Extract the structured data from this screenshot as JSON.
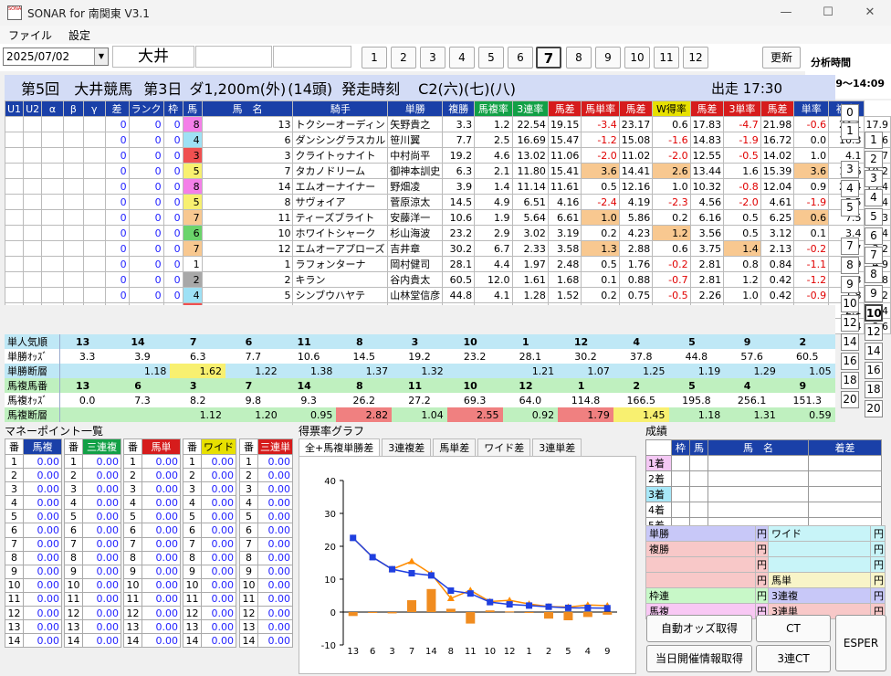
{
  "window": {
    "title": "SONAR for 南関東 V3.1",
    "icon_text": "SONAR",
    "min_glyph": "—",
    "max_glyph": "☐",
    "close_glyph": "✕"
  },
  "menu": [
    "ファイル",
    "設定"
  ],
  "toolbar": {
    "date": "2025/07/02",
    "venue": "大井",
    "races": [
      "1",
      "2",
      "3",
      "4",
      "5",
      "6",
      "7",
      "8",
      "9",
      "10",
      "11",
      "12"
    ],
    "selected_race": "7",
    "update_label": "更新"
  },
  "analysis": {
    "label": "分析時間",
    "time": "14:09～14:09"
  },
  "race": {
    "round": "第5回",
    "course": "大井競馬",
    "day": "第3日",
    "distance": "ダ1,200m(外)",
    "heads": "(14頭)",
    "start_label": "発走時刻",
    "class": "C2(六)(七)(八)",
    "post": "出走 17:30"
  },
  "table": {
    "headers": [
      "U1",
      "U2",
      "α",
      "β",
      "γ",
      "差",
      "ランク",
      "枠",
      "馬",
      "馬　名",
      "騎手",
      "単勝",
      "複勝",
      "馬複率",
      "3連率",
      "馬差",
      "馬単率",
      "馬差",
      "W得率",
      "馬差",
      "3単率",
      "馬差",
      "単率",
      "複率"
    ],
    "rows": [
      {
        "g": "0",
        "d": "0",
        "r": "0",
        "w": "8",
        "wc": "hl-p",
        "n": "13",
        "name": "トクシーオーディン",
        "j": "矢野貴之",
        "t": "3.3",
        "f": "1.2",
        "v": [
          "22.54",
          "19.15",
          "-3.4",
          "23.17",
          "0.6",
          "17.83",
          "-4.7",
          "21.98",
          "-0.6",
          "24.1",
          "17.9"
        ],
        "h": [
          "",
          "",
          "",
          "",
          "",
          "",
          "",
          "",
          "",
          "",
          ""
        ]
      },
      {
        "g": "0",
        "d": "0",
        "r": "0",
        "w": "4",
        "wc": "hl-bl",
        "n": "6",
        "name": "ダンシングラスカル",
        "j": "笹川翼",
        "t": "7.7",
        "f": "2.5",
        "v": [
          "16.69",
          "15.47",
          "-1.2",
          "15.08",
          "-1.6",
          "14.83",
          "-1.9",
          "16.72",
          "0.0",
          "10.3",
          "8.6"
        ],
        "h": [
          "",
          "",
          "",
          "",
          "",
          "",
          "",
          "",
          "",
          "",
          ""
        ]
      },
      {
        "g": "0",
        "d": "0",
        "r": "0",
        "w": "3",
        "wc": "hl-r",
        "n": "3",
        "name": "クライトゥナイト",
        "j": "中村尚平",
        "t": "19.2",
        "f": "4.6",
        "v": [
          "13.02",
          "11.06",
          "-2.0",
          "11.02",
          "-2.0",
          "12.55",
          "-0.5",
          "14.02",
          "1.0",
          "4.1",
          "4.7"
        ],
        "h": [
          "",
          "",
          "",
          "",
          "",
          "",
          "",
          "",
          "",
          "",
          ""
        ]
      },
      {
        "g": "0",
        "d": "0",
        "r": "0",
        "w": "5",
        "wc": "hl-y",
        "n": "7",
        "name": "タカノドリーム",
        "j": "御神本訓史",
        "t": "6.3",
        "f": "2.1",
        "v": [
          "11.80",
          "15.41",
          "3.6",
          "14.41",
          "2.6",
          "13.44",
          "1.6",
          "15.39",
          "3.6",
          "12.6",
          "10.2"
        ],
        "h": [
          "",
          "",
          "hl-o",
          "",
          "hl-o",
          "",
          "",
          "",
          "hl-o",
          "",
          ""
        ]
      },
      {
        "g": "0",
        "d": "0",
        "r": "0",
        "w": "8",
        "wc": "hl-p",
        "n": "14",
        "name": "エムオーナイナー",
        "j": "野畑凌",
        "t": "3.9",
        "f": "1.4",
        "v": [
          "11.14",
          "11.61",
          "0.5",
          "12.16",
          "1.0",
          "10.32",
          "-0.8",
          "12.04",
          "0.9",
          "20.4",
          "15.4"
        ],
        "h": [
          "",
          "",
          "",
          "",
          "",
          "",
          "",
          "",
          "",
          "",
          ""
        ]
      },
      {
        "g": "0",
        "d": "0",
        "r": "0",
        "w": "5",
        "wc": "hl-y",
        "n": "8",
        "name": "サヴォイア",
        "j": "菅原涼太",
        "t": "14.5",
        "f": "4.9",
        "v": [
          "6.51",
          "4.16",
          "-2.4",
          "4.19",
          "-2.3",
          "4.56",
          "-2.0",
          "4.61",
          "-1.9",
          "5.5",
          "4.4"
        ],
        "h": [
          "",
          "",
          "",
          "",
          "",
          "",
          "",
          "",
          "",
          "",
          ""
        ]
      },
      {
        "g": "0",
        "d": "0",
        "r": "0",
        "w": "7",
        "wc": "hl-o",
        "n": "11",
        "name": "ティーズブライト",
        "j": "安藤洋一",
        "t": "10.6",
        "f": "1.9",
        "v": [
          "5.64",
          "6.61",
          "1.0",
          "5.86",
          "0.2",
          "6.16",
          "0.5",
          "6.25",
          "0.6",
          "7.5",
          "11.3"
        ],
        "h": [
          "",
          "",
          "hl-o",
          "",
          "",
          "",
          "",
          "",
          "hl-o",
          "",
          ""
        ]
      },
      {
        "g": "0",
        "d": "0",
        "r": "0",
        "w": "6",
        "wc": "hl-g",
        "n": "10",
        "name": "ホワイトシャーク",
        "j": "杉山海波",
        "t": "23.2",
        "f": "2.9",
        "v": [
          "3.02",
          "3.19",
          "0.2",
          "4.23",
          "1.2",
          "3.56",
          "0.5",
          "3.12",
          "0.1",
          "3.4",
          "7.4"
        ],
        "h": [
          "",
          "",
          "",
          "",
          "hl-o",
          "",
          "",
          "",
          "",
          "",
          ""
        ]
      },
      {
        "g": "0",
        "d": "0",
        "r": "0",
        "w": "7",
        "wc": "hl-o",
        "n": "12",
        "name": "エムオーアプローズ",
        "j": "吉井章",
        "t": "30.2",
        "f": "6.7",
        "v": [
          "2.33",
          "3.58",
          "1.3",
          "2.88",
          "0.6",
          "3.75",
          "1.4",
          "2.13",
          "-0.2",
          "2.7",
          "3.2"
        ],
        "h": [
          "",
          "",
          "hl-o",
          "",
          "",
          "",
          "hl-o",
          "",
          "",
          "",
          ""
        ]
      },
      {
        "g": "0",
        "d": "0",
        "r": "0",
        "w": "1",
        "wc": "",
        "n": "1",
        "name": "ラフォンターナ",
        "j": "岡村健司",
        "t": "28.1",
        "f": "4.4",
        "v": [
          "1.97",
          "2.48",
          "0.5",
          "1.76",
          "-0.2",
          "2.81",
          "0.8",
          "0.84",
          "-1.1",
          "2.9",
          "4.9"
        ],
        "h": [
          "",
          "",
          "",
          "",
          "",
          "",
          "",
          "",
          "",
          "",
          ""
        ]
      },
      {
        "g": "0",
        "d": "0",
        "r": "0",
        "w": "2",
        "wc": "hl-gr",
        "n": "2",
        "name": "キラン",
        "j": "谷内貴太",
        "t": "60.5",
        "f": "12.0",
        "v": [
          "1.61",
          "1.68",
          "0.1",
          "0.88",
          "-0.7",
          "2.81",
          "1.2",
          "0.42",
          "-1.2",
          "1.3",
          "1.8"
        ],
        "h": [
          "",
          "",
          "",
          "",
          "",
          "",
          "",
          "",
          "",
          "",
          ""
        ]
      },
      {
        "g": "0",
        "d": "0",
        "r": "0",
        "w": "4",
        "wc": "hl-bl",
        "n": "5",
        "name": "シンブウハヤテ",
        "j": "山林堂信彦",
        "t": "44.8",
        "f": "4.1",
        "v": [
          "1.28",
          "1.52",
          "0.2",
          "0.75",
          "-0.5",
          "2.26",
          "1.0",
          "0.42",
          "-0.9",
          "1.8",
          "5.2"
        ],
        "h": [
          "",
          "",
          "",
          "",
          "",
          "",
          "",
          "",
          "",
          "",
          ""
        ]
      },
      {
        "g": "0",
        "d": "0",
        "r": "0",
        "w": "3",
        "wc": "hl-r",
        "n": "4",
        "name": "イクノオリンピア",
        "j": "瀬川将輝",
        "t": "37.8",
        "f": "15.6",
        "v": [
          "1.26",
          "2.16",
          "0.9",
          "1.72",
          "0.5",
          "2.20",
          "0.9",
          "1.03",
          "-0.2",
          "2.1",
          "1.4"
        ],
        "h": [
          "",
          "",
          "",
          "",
          "",
          "",
          "",
          "",
          "",
          "",
          ""
        ]
      },
      {
        "g": "0",
        "d": "0",
        "r": "0",
        "w": "6",
        "wc": "hl-g",
        "n": "9",
        "name": "ショーシャンク",
        "j": "藤本現暉",
        "t": "57.6",
        "f": "6.0",
        "v": [
          "1.17",
          "1.93",
          "0.8",
          "1.89",
          "0.7",
          "2.92",
          "1.8",
          "1.03",
          "-0.1",
          "1.4",
          "3.6"
        ],
        "h": [
          "",
          "",
          "",
          "",
          "",
          "",
          "",
          "",
          "",
          "",
          ""
        ]
      }
    ]
  },
  "side_buttons_left": [
    "0",
    "1",
    "2",
    "3",
    "4",
    "5",
    "6",
    "7",
    "8",
    "9",
    "10",
    "11",
    "12",
    "13",
    "14",
    "15",
    "16",
    "17",
    "18",
    "19",
    "20"
  ],
  "side_buttons_right": [
    "1",
    "2",
    "3",
    "4",
    "5",
    "6",
    "7",
    "8",
    "9",
    "10",
    "12",
    "14",
    "16",
    "18",
    "20"
  ],
  "stats": {
    "tan_ninki": {
      "label": "単人気順",
      "values": [
        "13",
        "14",
        "7",
        "6",
        "11",
        "8",
        "3",
        "10",
        "1",
        "12",
        "4",
        "5",
        "9",
        "2"
      ]
    },
    "tan_odds": {
      "label": "単勝ｵｯｽﾞ",
      "values": [
        "3.3",
        "3.9",
        "6.3",
        "7.7",
        "10.6",
        "14.5",
        "19.2",
        "23.2",
        "28.1",
        "30.2",
        "37.8",
        "44.8",
        "57.6",
        "60.5"
      ]
    },
    "tan_dan": {
      "label": "単勝断層",
      "values": [
        "1.18",
        "1.62",
        "1.22",
        "1.38",
        "1.37",
        "1.32",
        "1.21",
        "1.07",
        "1.25",
        "1.19",
        "1.29",
        "1.05"
      ]
    },
    "fuku_ban": {
      "label": "馬複馬番",
      "values": [
        "13",
        "6",
        "3",
        "7",
        "14",
        "8",
        "11",
        "10",
        "12",
        "1",
        "2",
        "5",
        "4",
        "9"
      ]
    },
    "fuku_odds": {
      "label": "馬複ｵｯｽﾞ",
      "values": [
        "0.0",
        "7.3",
        "8.2",
        "9.8",
        "9.3",
        "26.2",
        "27.2",
        "69.3",
        "64.0",
        "114.8",
        "166.5",
        "195.8",
        "256.1",
        "151.3"
      ]
    },
    "fuku_dan": {
      "label": "馬複断層",
      "values": [
        "1.12",
        "1.20",
        "0.95",
        "2.82",
        "1.04",
        "2.55",
        "0.92",
        "1.79",
        "1.45",
        "1.18",
        "1.31",
        "0.59"
      ]
    }
  },
  "money": {
    "title": "マネーポイント一覧",
    "headers": [
      "番",
      "馬複",
      "番",
      "三連複",
      "番",
      "馬単",
      "番",
      "ワイド",
      "番",
      "三連単"
    ],
    "rows": [
      "1",
      "2",
      "3",
      "4",
      "5",
      "6",
      "7",
      "8",
      "9",
      "10",
      "11",
      "12",
      "13",
      "14"
    ],
    "value": "0.00"
  },
  "graph": {
    "title": "得票率グラフ",
    "tabs": [
      "全+馬複単勝差",
      "3連複差",
      "馬単差",
      "ワイド差",
      "3連単差"
    ]
  },
  "chart_data": {
    "type": "line",
    "categories": [
      "13",
      "6",
      "3",
      "7",
      "14",
      "8",
      "11",
      "10",
      "12",
      "1",
      "2",
      "5",
      "4",
      "9"
    ],
    "ylim": [
      -10,
      40
    ],
    "yticks": [
      "40",
      "30",
      "20",
      "10",
      "0",
      "-10"
    ],
    "series": [
      {
        "values": [
          22.54,
          16.69,
          13.02,
          11.8,
          11.14,
          6.51,
          5.64,
          3.02,
          2.33,
          1.97,
          1.61,
          1.28,
          1.26,
          1.17
        ],
        "color": "#1f3fe0"
      },
      {
        "values": [
          22.54,
          16.69,
          13.02,
          15.41,
          11.61,
          4.16,
          6.61,
          3.19,
          3.58,
          2.48,
          1.68,
          1.52,
          2.16,
          1.93
        ],
        "color": "#ff8c00"
      }
    ],
    "bars": [
      -1.2,
      0.0,
      -0.4,
      3.6,
      7.0,
      1.0,
      -3.5,
      0.5,
      0.2,
      0.0,
      -2.0,
      -2.5,
      -1.5,
      -0.8
    ]
  },
  "seiseki": {
    "title": "成績",
    "headers": [
      "枠",
      "馬",
      "馬　名",
      "着差"
    ],
    "rows": [
      "1着",
      "2着",
      "3着",
      "4着",
      "5着"
    ]
  },
  "payout": {
    "tansho": "単勝",
    "fukusho": "複勝",
    "wide": "ワイド",
    "umatan": "馬単",
    "wakuren": "枠連",
    "sanrenfuku": "3連複",
    "umafuku": "馬複",
    "sanrentan": "3連単",
    "yen": "円"
  },
  "buttons": {
    "auto_odds": "自動オッズ取得",
    "ct": "CT",
    "esper": "ESPER",
    "today_info": "当日開催情報取得",
    "sanren_ct": "3連CT"
  }
}
